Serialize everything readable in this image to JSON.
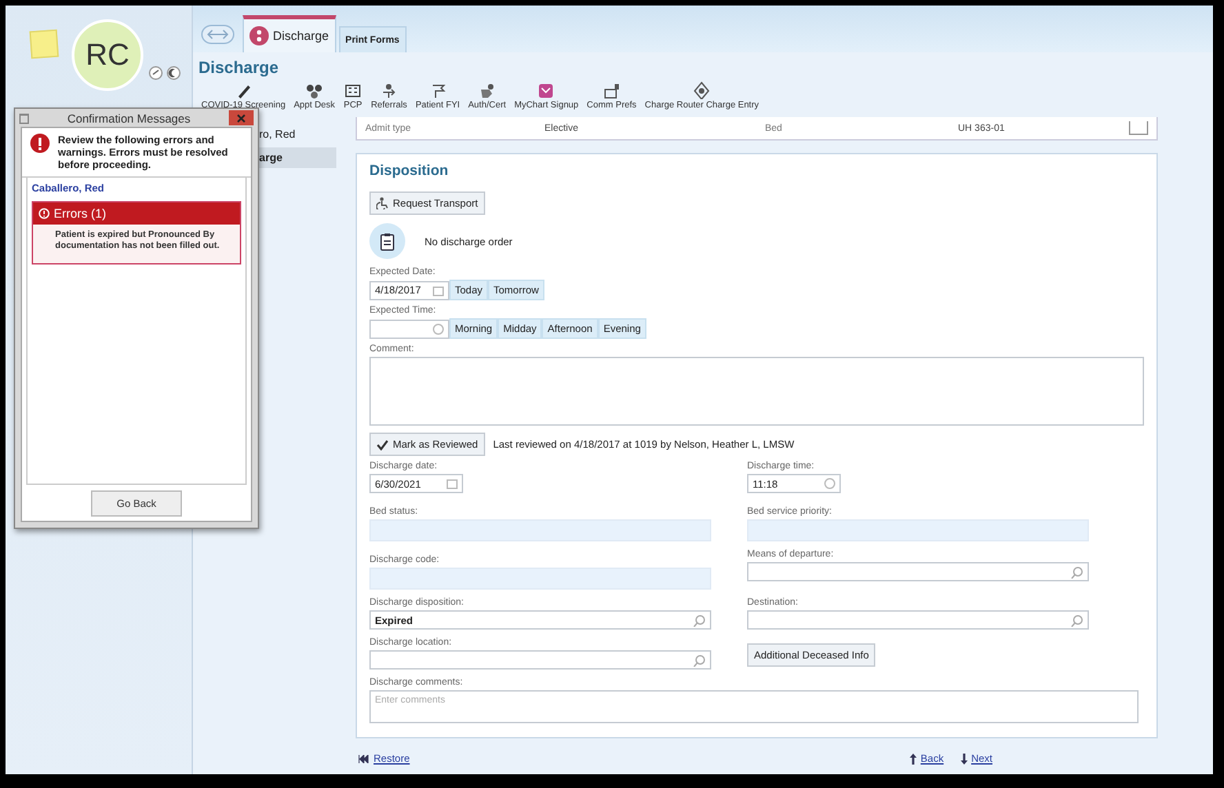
{
  "patient": {
    "initials": "RC"
  },
  "tabs": [
    {
      "label": "Discharge",
      "selected": true
    },
    {
      "label": "Print Forms",
      "selected": false
    }
  ],
  "activity_title": "Discharge",
  "toolbar": [
    {
      "label": "COVID-19 Screening"
    },
    {
      "label": "Appt Desk"
    },
    {
      "label": "PCP"
    },
    {
      "label": "Referrals"
    },
    {
      "label": "Patient FYI"
    },
    {
      "label": "Auth/Cert"
    },
    {
      "label": "MyChart Signup"
    },
    {
      "label": "Comm Prefs"
    },
    {
      "label": "Charge Router Charge Entry"
    }
  ],
  "nav": [
    {
      "label": "ro, Red",
      "selected": false
    },
    {
      "label": "arge",
      "selected": true
    }
  ],
  "admit_row": {
    "label": "Admit type",
    "value": "Elective",
    "label_2": "Bed",
    "value_2": "UH 363-01"
  },
  "disposition": {
    "title": "Disposition",
    "request_button": "Request Transport",
    "order_status": "No discharge order",
    "expected_date": {
      "label": "Expected Date:",
      "value": "4/18/2017",
      "buttons": [
        "Today",
        "Tomorrow"
      ]
    },
    "expected_time": {
      "label": "Expected Time:",
      "buttons": [
        "Morning",
        "Midday",
        "Afternoon",
        "Evening"
      ]
    },
    "comment": {
      "label": "Comment:"
    },
    "review": {
      "button": "Mark as Reviewed",
      "text": "Last reviewed on 4/18/2017 at 1019 by Nelson, Heather L, LMSW"
    },
    "fields": [
      {
        "kind": "date",
        "label": "Discharge date:",
        "value": "6/30/2021"
      },
      {
        "kind": "time",
        "label": "Discharge time:",
        "value": "11:18"
      },
      {
        "kind": "readonly",
        "label": "Bed status:"
      },
      {
        "kind": "readonly",
        "label": "Bed service priority:"
      },
      {
        "kind": "readonly",
        "label": "Discharge code:"
      },
      {
        "kind": "lookup",
        "label": "Means of departure:"
      },
      {
        "kind": "lookup",
        "label": "Discharge disposition:",
        "value": "Expired"
      },
      {
        "kind": "lookup",
        "label": "Destination:"
      },
      {
        "kind": "lookup",
        "label": "Discharge location:"
      },
      {
        "kind": "button",
        "label": "Additional Deceased Info"
      },
      {
        "kind": "textarea",
        "label": "Discharge comments:",
        "placeholder": "Enter comments"
      }
    ]
  },
  "footer": {
    "restore": "Restore",
    "back": "Back",
    "next": "Next"
  },
  "dialog": {
    "title": "Confirmation Messages",
    "message": "Review the following errors and warnings. Errors must be resolved before proceeding.",
    "patient_link": "Caballero, Red",
    "errors_header": "Errors (1)",
    "error_text": "Patient is expired but Pronounced By documentation has not been filled out.",
    "button": "Go Back"
  }
}
